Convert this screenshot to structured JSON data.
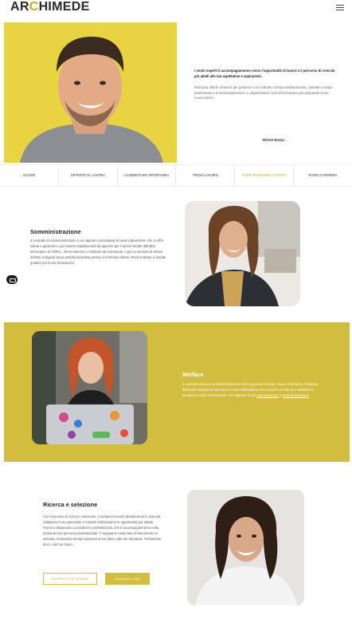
{
  "header": {
    "logo_main_left": "AR",
    "logo_accent": "C",
    "logo_main_right": "HIMEDE"
  },
  "hero": {
    "lead": "I nostri esperti ti accompagneranno verso l'opportunità di lavoro e il percorso di crescita più adatti alle tue aspettative e aspirazioni.",
    "body": "Riceverai offerte di lavoro per posizioni con contratto a tempo indeterminato, contratti a tempo determinato o in somministrazione, e organizziamo corsi di formazione per prepararti al tuo nuovo lavoro.",
    "cta": "TROVA RUOLI →"
  },
  "tabs": [
    {
      "label": "ACCEDI"
    },
    {
      "label": "OFFERTE DI LAVORO"
    },
    {
      "label": "CANDIDATURA SPONTANEA"
    },
    {
      "label": "TROVA LAVORO"
    },
    {
      "label": "COME POSSIAMO AIUTARTI"
    },
    {
      "label": "RADIO CARRIERA"
    }
  ],
  "somministrazione": {
    "title": "Somministrazione",
    "body": "Il contratto in somministrazione è un rapporto contrattuale di lavoro dipendente che si offre salute e garanzie e può essere stipulato solo da agenzie per il lavoro iscritte dall'albo informatico di ANPAL. Verrai assunto e retribuito da Archimede, e per un periodo di tempo definito svolgerai la tua attività lavorativa presso un'Azienda cliente. Resti motivato e lasciati guidare per la tua formazione!"
  },
  "welfare": {
    "title": "Welfare",
    "body": "Il contratto di lavoro in somministrazione offre garanzie e tutele. Grazie a Ebitemp, il sistema bilaterale dedicato ai lavoratori in somministrazione per accedere a rimborsi e assistenza sanitaria e corsi di formazione. Per saperne di più",
    "link1": "www.ebitemp.it",
    "link_sep": " e ",
    "link2": "www.formatemp.it"
  },
  "ricerca": {
    "title": "Ricerca e selezione",
    "body": "Con il servizio di ricerca e selezione, ti aiutiamo inserirti direttamente in azienda. Valutiamo il tuo potenziale e insieme individuiamo le opportunità più adatte. Forniti e disponiamo consulenti e professionisti, che ti accompagneranno nella scelta del tuo percorso professionale. Ti seguiamo nella fase di inserimento in azienda, rimanendo sempre presenti al tuo fianco alle tue domande. Parliamone di te e del tuo futuro.",
    "btn_outline": "SCOPRI DI PIÙ SERVIZI",
    "btn_fill": "CANDIDATI ORA"
  },
  "colors": {
    "accent": "#d2bd3e",
    "accent_text": "#c9a82a",
    "hero_bg": "#e8d441"
  }
}
